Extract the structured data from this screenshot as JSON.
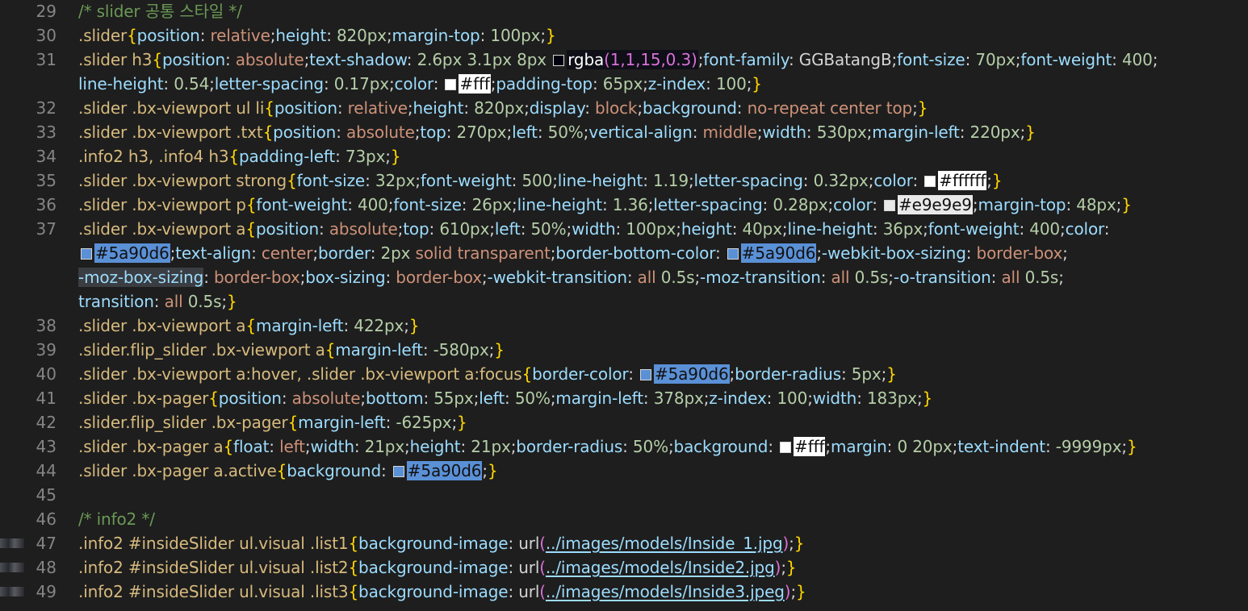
{
  "editor": {
    "lines": {
      "l29": {
        "num": "29",
        "comment": "/* slider 공통 스타일 */"
      },
      "l30": {
        "num": "30",
        "selector": ".slider",
        "p1": "position",
        "v1": "relative",
        "p2": "height",
        "v2": "820px",
        "p3": "margin-top",
        "v3": "100px"
      },
      "l31": {
        "num": "31",
        "selector": ".slider h3",
        "p1": "position",
        "v1": "absolute",
        "p2": "text-shadow",
        "v2": "2.6px 3.1px 8px",
        "swatch": "#01010f",
        "v2c": "rgba",
        "v2d": "(1,1,15,0.3)",
        "p3": "font-family",
        "v3": "GGBatangB",
        "p4": "font-size",
        "v4": "70px",
        "p5": "font-weight",
        "v5": "400"
      },
      "l31b": {
        "p6": "line-height",
        "v6": "0.54",
        "p7": "letter-spacing",
        "v7": "0.17px",
        "p8": "color",
        "swatch": "#ffffff",
        "v8": "#fff",
        "p9": "padding-top",
        "v9": "65px",
        "p10": "z-index",
        "v10": "100"
      },
      "l32": {
        "num": "32",
        "selector": ".slider .bx-viewport ul li",
        "p1": "position",
        "v1": "relative",
        "p2": "height",
        "v2": "820px",
        "p3": "display",
        "v3": "block",
        "p4": "background",
        "v4": "no-repeat center top"
      },
      "l33": {
        "num": "33",
        "selector": ".slider .bx-viewport .txt",
        "p1": "position",
        "v1": "absolute",
        "p2": "top",
        "v2": "270px",
        "p3": "left",
        "v3": "50%",
        "p4": "vertical-align",
        "v4": "middle",
        "p5": "width",
        "v5": "530px",
        "p6": "margin-left",
        "v6": "220px"
      },
      "l34": {
        "num": "34",
        "selector": ".info2 h3, .info4 h3",
        "p1": "padding-left",
        "v1": "73px"
      },
      "l35": {
        "num": "35",
        "selector": ".slider .bx-viewport strong",
        "p1": "font-size",
        "v1": "32px",
        "p2": "font-weight",
        "v2": "500",
        "p3": "line-height",
        "v3": "1.19",
        "p4": "letter-spacing",
        "v4": "0.32px",
        "p5": "color",
        "swatch": "#ffffff",
        "v5": "#ffffff"
      },
      "l36": {
        "num": "36",
        "selector": ".slider .bx-viewport p",
        "p1": "font-weight",
        "v1": "400",
        "p2": "font-size",
        "v2": "26px",
        "p3": "line-height",
        "v3": "1.36",
        "p4": "letter-spacing",
        "v4": "0.28px",
        "p5": "color",
        "swatch": "#e9e9e9",
        "v5": "#e9e9e9",
        "p6": "margin-top",
        "v6": "48px"
      },
      "l37": {
        "num": "37",
        "selector": ".slider .bx-viewport a",
        "p1": "position",
        "v1": "absolute",
        "p2": "top",
        "v2": "610px",
        "p3": "left",
        "v3": "50%",
        "p4": "width",
        "v4": "100px",
        "p5": "height",
        "v5": "40px",
        "p6": "line-height",
        "v6": "36px",
        "p7": "font-weight",
        "v7": "400",
        "p8": "color"
      },
      "l37b": {
        "swatch": "#5a90d6",
        "v8": "#5a90d6",
        "p9": "text-align",
        "v9": "center",
        "p10": "border",
        "v10a": "2px",
        "v10b": "solid transparent",
        "p11": "border-bottom-color",
        "v11": "#5a90d6",
        "p12": "-webkit-box-sizing",
        "v12": "border-box"
      },
      "l37c": {
        "p13": "-moz-box-sizing",
        "v13": "border-box",
        "p14": "box-sizing",
        "v14": "border-box",
        "p15": "-webkit-transition",
        "v15a": "all",
        "v15b": "0.5s",
        "p16": "-moz-transition",
        "v16a": "all",
        "v16b": "0.5s",
        "p17": "-o-transition",
        "v17a": "all",
        "v17b": "0.5s"
      },
      "l37d": {
        "p18": "transition",
        "v18a": "all",
        "v18b": "0.5s"
      },
      "l38": {
        "num": "38",
        "selector": ".slider .bx-viewport a",
        "p1": "margin-left",
        "v1": "422px"
      },
      "l39": {
        "num": "39",
        "selector": ".slider.flip_slider .bx-viewport a",
        "p1": "margin-left",
        "v1": "-580px"
      },
      "l40": {
        "num": "40",
        "selector": ".slider .bx-viewport a:hover, .slider .bx-viewport a:focus",
        "p1": "border-color",
        "swatch": "#5a90d6",
        "v1": "#5a90d6",
        "p2": "border-radius",
        "v2": "5px"
      },
      "l41": {
        "num": "41",
        "selector": ".slider .bx-pager",
        "p1": "position",
        "v1": "absolute",
        "p2": "bottom",
        "v2": "55px",
        "p3": "left",
        "v3": "50%",
        "p4": "margin-left",
        "v4": "378px",
        "p5": "z-index",
        "v5": "100",
        "p6": "width",
        "v6": "183px"
      },
      "l42": {
        "num": "42",
        "selector": ".slider.flip_slider .bx-pager",
        "p1": "margin-left",
        "v1": "-625px"
      },
      "l43": {
        "num": "43",
        "selector": ".slider .bx-pager a",
        "p1": "float",
        "v1": "left",
        "p2": "width",
        "v2": "21px",
        "p3": "height",
        "v3": "21px",
        "p4": "border-radius",
        "v4": "50%",
        "p5": "background",
        "swatch": "#ffffff",
        "v5": "#fff",
        "p6": "margin",
        "v6": "0 20px",
        "p7": "text-indent",
        "v7": "-9999px"
      },
      "l44": {
        "num": "44",
        "selector": ".slider .bx-pager a.active",
        "p1": "background",
        "swatch": "#5a90d6",
        "v1": "#5a90d6"
      },
      "l45": {
        "num": "45"
      },
      "l46": {
        "num": "46",
        "comment": "/* info2 */"
      },
      "l47": {
        "num": "47",
        "selector": ".info2 #insideSlider ul.visual .list1",
        "p1": "background-image",
        "fn": "url",
        "url": "../images/models/Inside_1.jpg"
      },
      "l48": {
        "num": "48",
        "selector": ".info2 #insideSlider ul.visual .list2",
        "p1": "background-image",
        "fn": "url",
        "url": "../images/models/Inside2.jpg"
      },
      "l49": {
        "num": "49",
        "selector": ".info2 #insideSlider ul.visual .list3",
        "p1": "background-image",
        "fn": "url",
        "url": "../images/models/Inside3.jpeg"
      }
    }
  }
}
